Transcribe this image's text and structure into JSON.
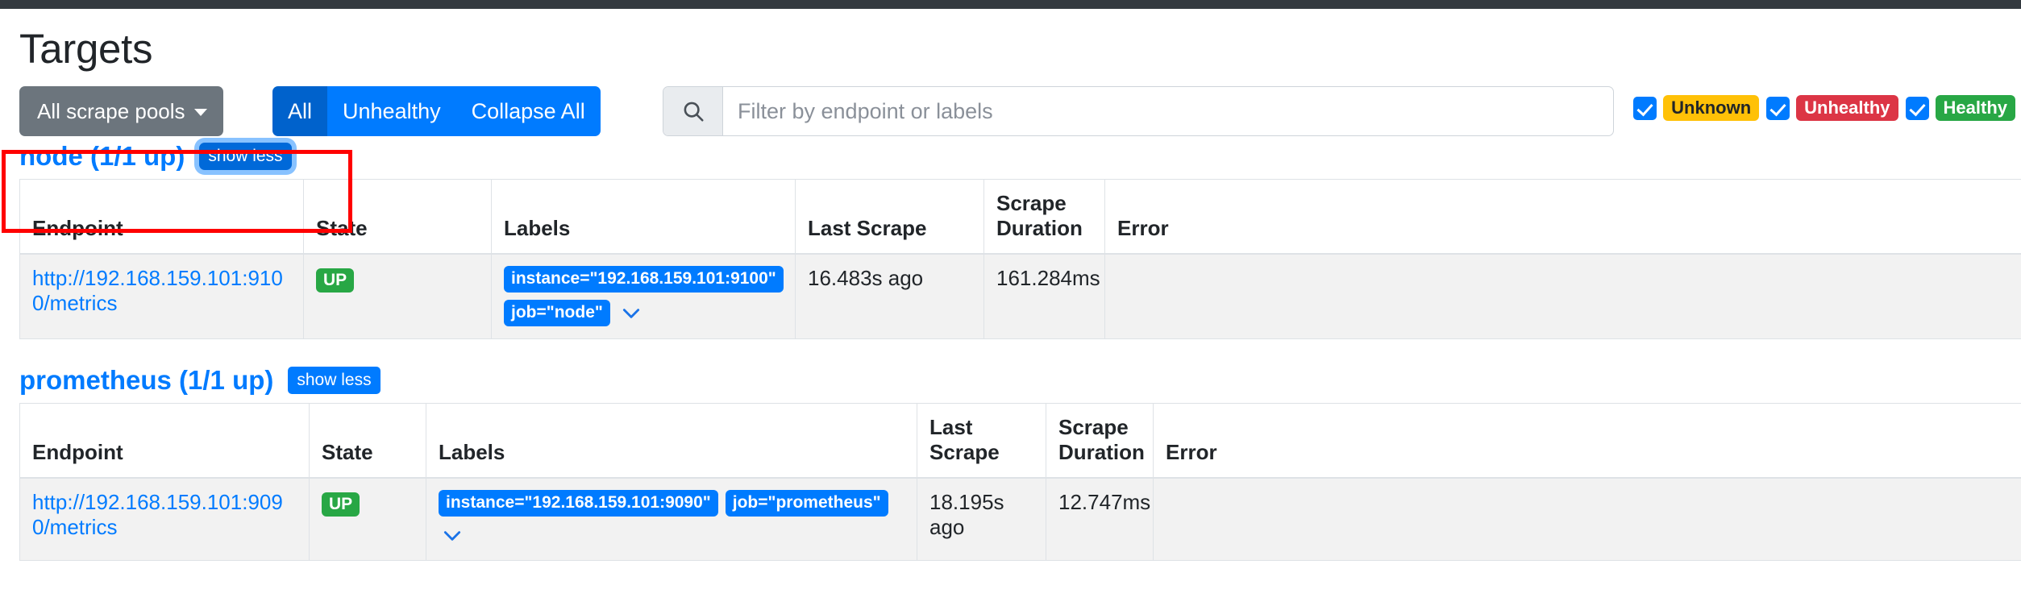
{
  "page": {
    "title": "Targets"
  },
  "toolbar": {
    "scrape_pools_label": "All scrape pools",
    "filter_buttons": [
      {
        "label": "All",
        "active": true
      },
      {
        "label": "Unhealthy",
        "active": false
      },
      {
        "label": "Collapse All",
        "active": false
      }
    ],
    "search": {
      "placeholder": "Filter by endpoint or labels",
      "value": "",
      "icon": "search-icon"
    },
    "health_filters": [
      {
        "label": "Unknown",
        "checked": true,
        "color": "#ffc107"
      },
      {
        "label": "Unhealthy",
        "checked": true,
        "color": "#dc3545"
      },
      {
        "label": "Healthy",
        "checked": true,
        "color": "#28a745"
      }
    ]
  },
  "columns": [
    "Endpoint",
    "State",
    "Labels",
    "Last Scrape",
    "Scrape Duration",
    "Error"
  ],
  "pools": [
    {
      "name": "node",
      "title": "node (1/1 up)",
      "toggle_label": "show less",
      "focused": true,
      "rows": [
        {
          "endpoint": "http://192.168.159.101:9100/metrics",
          "state": "UP",
          "labels": [
            "instance=\"192.168.159.101:9100\"",
            "job=\"node\""
          ],
          "last_scrape": "16.483s ago",
          "scrape_duration": "161.284ms",
          "error": ""
        }
      ]
    },
    {
      "name": "prometheus",
      "title": "prometheus (1/1 up)",
      "toggle_label": "show less",
      "focused": false,
      "rows": [
        {
          "endpoint": "http://192.168.159.101:9090/metrics",
          "state": "UP",
          "labels": [
            "instance=\"192.168.159.101:9090\"",
            "job=\"prometheus\""
          ],
          "last_scrape": "18.195s ago",
          "scrape_duration": "12.747ms",
          "error": ""
        }
      ]
    }
  ],
  "annotation": {
    "type": "red-highlight-box",
    "target": "node pool header"
  }
}
